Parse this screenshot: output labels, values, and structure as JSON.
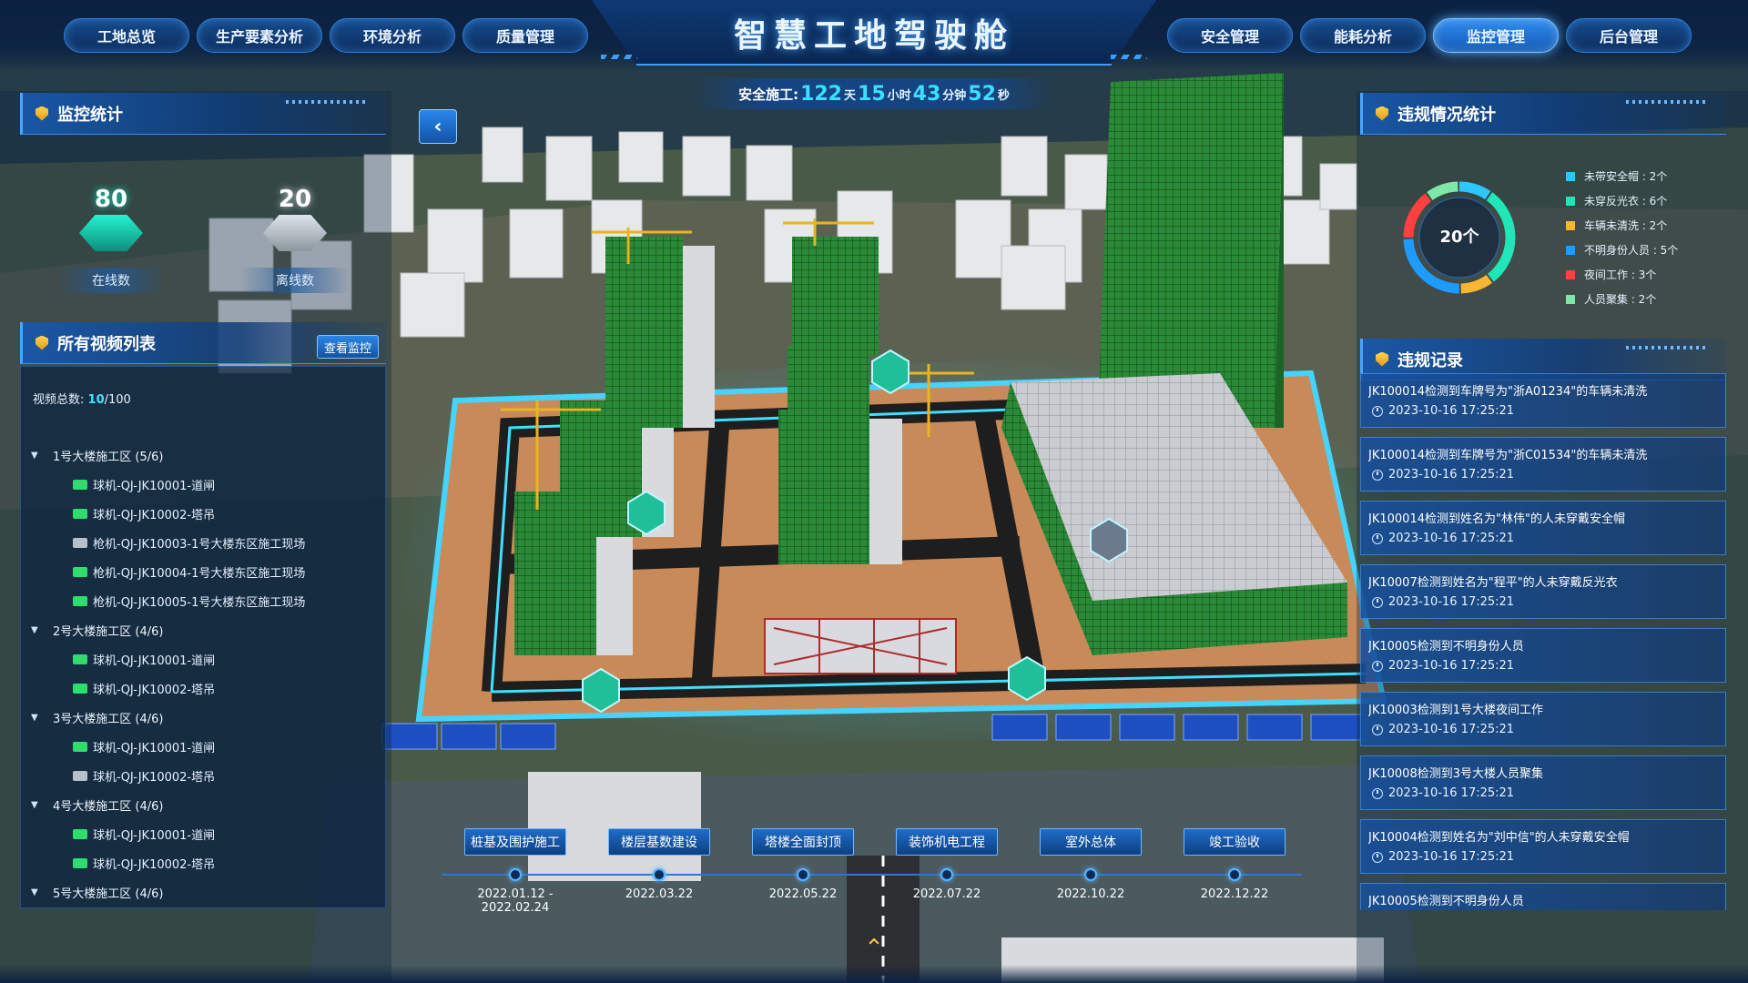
{
  "header": {
    "title": "智慧工地驾驶舱",
    "nav_left": [
      "工地总览",
      "生产要素分析",
      "环境分析",
      "质量管理"
    ],
    "nav_right": [
      "安全管理",
      "能耗分析",
      "监控管理",
      "后台管理"
    ],
    "active_tab": "监控管理"
  },
  "safety_timer": {
    "label": "安全施工:",
    "days": "122",
    "days_unit": "天",
    "hours": "15",
    "hours_unit": "小时",
    "minutes": "43",
    "minutes_unit": "分钟",
    "seconds": "52",
    "seconds_unit": "秒"
  },
  "monitor_stats": {
    "title": "监控统计",
    "online": {
      "value": "80",
      "label": "在线数",
      "color": "#1fe3c4"
    },
    "offline": {
      "value": "20",
      "label": "离线数",
      "color": "#b8c2cc"
    }
  },
  "video_list": {
    "title": "所有视频列表",
    "view_button": "查看监控",
    "total_label": "视频总数:",
    "total_current": "10",
    "total_max": "/100",
    "groups": [
      {
        "name": "1号大楼施工区 (5/6)",
        "items": [
          {
            "label": "球机-QJ-JK10001-道闸",
            "online": true
          },
          {
            "label": "球机-QJ-JK10002-塔吊",
            "online": true
          },
          {
            "label": "枪机-QJ-JK10003-1号大楼东区施工现场",
            "online": false
          },
          {
            "label": "枪机-QJ-JK10004-1号大楼东区施工现场",
            "online": true
          },
          {
            "label": "枪机-QJ-JK10005-1号大楼东区施工现场",
            "online": true
          }
        ]
      },
      {
        "name": "2号大楼施工区 (4/6)",
        "items": [
          {
            "label": "球机-QJ-JK10001-道闸",
            "online": true
          },
          {
            "label": "球机-QJ-JK10002-塔吊",
            "online": true
          }
        ]
      },
      {
        "name": "3号大楼施工区 (4/6)",
        "items": [
          {
            "label": "球机-QJ-JK10001-道闸",
            "online": true
          },
          {
            "label": "球机-QJ-JK10002-塔吊",
            "online": false
          }
        ]
      },
      {
        "name": "4号大楼施工区 (4/6)",
        "items": [
          {
            "label": "球机-QJ-JK10001-道闸",
            "online": true
          },
          {
            "label": "球机-QJ-JK10002-塔吊",
            "online": true
          }
        ]
      },
      {
        "name": "5号大楼施工区 (4/6)",
        "items": []
      }
    ]
  },
  "violation_stats": {
    "title": "违规情况统计",
    "total": "20个",
    "legend": [
      {
        "label": "未带安全帽 : 2个",
        "color": "#2bc8ff",
        "value": 2
      },
      {
        "label": "未穿反光衣 : 6个",
        "color": "#21e6b8",
        "value": 6
      },
      {
        "label": "车辆未清洗 : 2个",
        "color": "#f7b733",
        "value": 2
      },
      {
        "label": "不明身份人员 : 5个",
        "color": "#1e9bff",
        "value": 5
      },
      {
        "label": "夜间工作 : 3个",
        "color": "#ff4040",
        "value": 3
      },
      {
        "label": "人员聚集 : 2个",
        "color": "#7ee8a8",
        "value": 2
      }
    ]
  },
  "violation_records": {
    "title": "违规记录",
    "items": [
      {
        "msg": "JK100014检测到车牌号为\"浙A01234\"的车辆未清洗",
        "time": "2023-10-16 17:25:21"
      },
      {
        "msg": "JK100014检测到车牌号为\"浙C01534\"的车辆未清洗",
        "time": "2023-10-16 17:25:21"
      },
      {
        "msg": "JK100014检测到姓名为\"林伟\"的人未穿戴安全帽",
        "time": "2023-10-16 17:25:21"
      },
      {
        "msg": "JK10007检测到姓名为\"程平\"的人未穿戴反光衣",
        "time": "2023-10-16 17:25:21"
      },
      {
        "msg": "JK10005检测到不明身份人员",
        "time": "2023-10-16 17:25:21"
      },
      {
        "msg": "JK10003检测到1号大楼夜间工作",
        "time": "2023-10-16 17:25:21"
      },
      {
        "msg": "JK10008检测到3号大楼人员聚集",
        "time": "2023-10-16 17:25:21"
      },
      {
        "msg": "JK10004检测到姓名为\"刘中信\"的人未穿戴安全帽",
        "time": "2023-10-16 17:25:21"
      },
      {
        "msg": "JK10005检测到不明身份人员",
        "time": ""
      }
    ]
  },
  "timeline": {
    "stages": [
      {
        "label": "桩基及围护施工",
        "date": "2022.01.12 - 2022.02.24"
      },
      {
        "label": "楼层基数建设",
        "date": "2022.03.22"
      },
      {
        "label": "塔楼全面封顶",
        "date": "2022.05.22"
      },
      {
        "label": "装饰机电工程",
        "date": "2022.07.22"
      },
      {
        "label": "室外总体",
        "date": "2022.10.22"
      },
      {
        "label": "竣工验收",
        "date": "2022.12.22"
      }
    ]
  },
  "colors": {
    "accent": "#3aa0ff",
    "header_bg": "#092042",
    "highlight": "#39e0ff",
    "online": "#2fdc6e",
    "offline": "#b6c1cc"
  }
}
